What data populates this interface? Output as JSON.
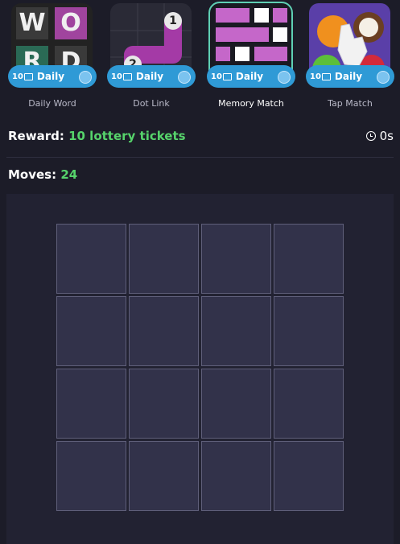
{
  "games": [
    {
      "name": "Daily Word",
      "ticket_count": "10",
      "frequency": "Daily",
      "selected": false,
      "thumb_letters": [
        "W",
        "O",
        "R",
        "D"
      ]
    },
    {
      "name": "Dot Link",
      "ticket_count": "10",
      "frequency": "Daily",
      "selected": false,
      "thumb_dots": [
        "1",
        "2"
      ]
    },
    {
      "name": "Memory Match",
      "ticket_count": "10",
      "frequency": "Daily",
      "selected": true
    },
    {
      "name": "Tap Match",
      "ticket_count": "10",
      "frequency": "Daily",
      "selected": false
    }
  ],
  "reward": {
    "label": "Reward:",
    "value": "10 lottery tickets"
  },
  "timer": {
    "value": "0s",
    "icon": "clock-icon"
  },
  "moves": {
    "label": "Moves:",
    "value": "24"
  },
  "board": {
    "rows": 4,
    "cols": 4,
    "cards_face_down": 16
  },
  "colors": {
    "background": "#1c1c28",
    "accent_green": "#56d36b",
    "badge_blue": "#2f9ad6",
    "card": "#32324a",
    "selected_outline": "#5fd0b4"
  }
}
